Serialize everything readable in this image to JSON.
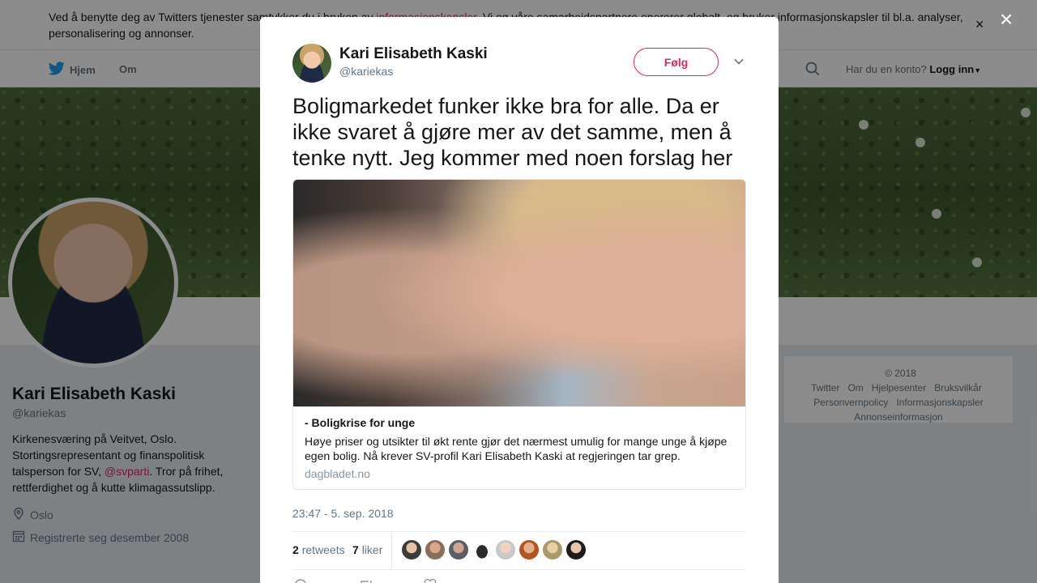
{
  "cookie_bar": {
    "text_before": "Ved å benytte deg av Twitters tjenester samtykker du i bruken av ",
    "link": "informasjonskapsler",
    "text_after": ". Vi og våre samarbeidspartnere opererer globalt, og bruker informasjonskapsler til bl.a. analyser, personalisering og annonser.",
    "close": "×"
  },
  "nav": {
    "home": "Hjem",
    "about": "Om",
    "account_prompt": "Har du en konto?",
    "login": "Logg inn"
  },
  "profile": {
    "name": "Kari Elisabeth Kaski",
    "handle": "@kariekas",
    "bio_before": "Kirkenesværing på Veitvet, Oslo. Stortingsrepresentant og finanspolitisk talsperson for SV, ",
    "bio_mention": "@svparti",
    "bio_after": ". Tror på frihet, rettferdighet og å kutte klimagassutslipp.",
    "location": "Oslo",
    "joined": "Registrerte seg desember 2008"
  },
  "footer": {
    "items": [
      "© 2018 Twitter",
      "Om",
      "Hjelpesenter",
      "Bruksvilkår",
      "Personvernpolicy",
      "Informasjonskapsler",
      "Annonseinformasjon"
    ]
  },
  "modal": {
    "close": "×",
    "name": "Kari Elisabeth Kaski",
    "handle": "@kariekas",
    "follow": "Følg",
    "tweet_text": "Boligmarkedet funker ikke bra for alle. Da er ikke svaret å gjøre mer av det samme, men å tenke nytt. Jeg kommer med noen forslag her",
    "card": {
      "title": "- Boligkrise for unge",
      "description": "Høye priser og utsikter til økt rente gjør det nærmest umulig for mange unge å kjøpe egen bolig. Nå krever SV-profil Kari Elisabeth Kaski at regjeringen tar grep.",
      "domain": "dagbladet.no"
    },
    "timestamp": "23:47 - 5. sep. 2018",
    "stats": {
      "retweets_count": "2",
      "retweets_label": "retweets",
      "likes_count": "7",
      "likes_label": "liker"
    }
  },
  "colors": {
    "accent": "#e0245e",
    "text": "#14171a",
    "muted": "#657786"
  }
}
